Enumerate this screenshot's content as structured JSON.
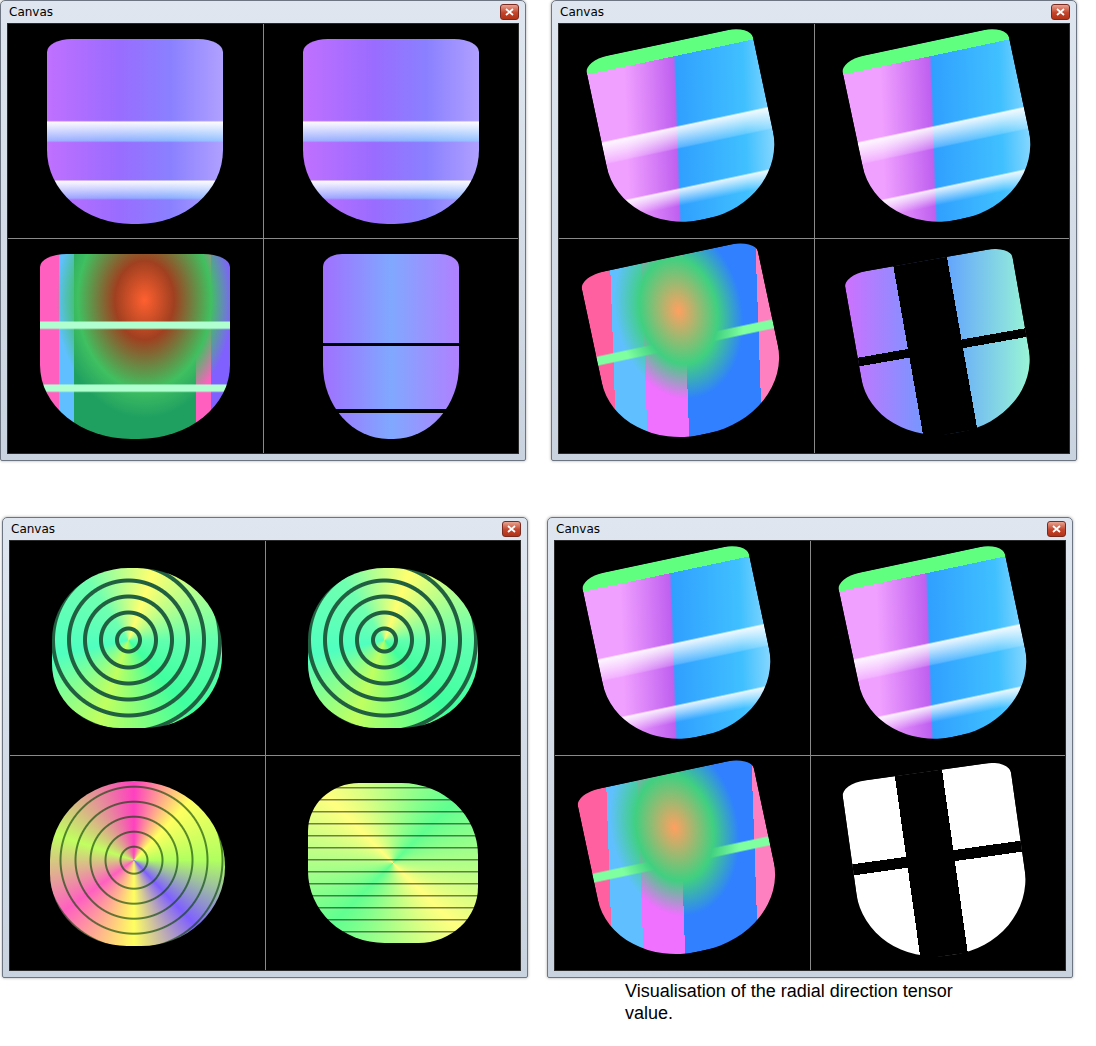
{
  "windows": [
    {
      "title": "Canvas",
      "views": [
        {
          "kind": "front-surface"
        },
        {
          "kind": "front-surface"
        },
        {
          "kind": "front-cutaway"
        },
        {
          "kind": "front-inner"
        }
      ]
    },
    {
      "title": "Canvas",
      "views": [
        {
          "kind": "oblique-surface"
        },
        {
          "kind": "oblique-surface"
        },
        {
          "kind": "oblique-cutaway"
        },
        {
          "kind": "oblique-inner"
        }
      ]
    },
    {
      "title": "Canvas",
      "views": [
        {
          "kind": "top-slice"
        },
        {
          "kind": "top-slice"
        },
        {
          "kind": "top-cutaway"
        },
        {
          "kind": "top-inner"
        }
      ]
    },
    {
      "title": "Canvas",
      "views": [
        {
          "kind": "oblique-surface"
        },
        {
          "kind": "oblique-surface"
        },
        {
          "kind": "oblique-cutaway"
        },
        {
          "kind": "mask"
        }
      ]
    }
  ],
  "caption": "Visualisation of the radial direction tensor value."
}
